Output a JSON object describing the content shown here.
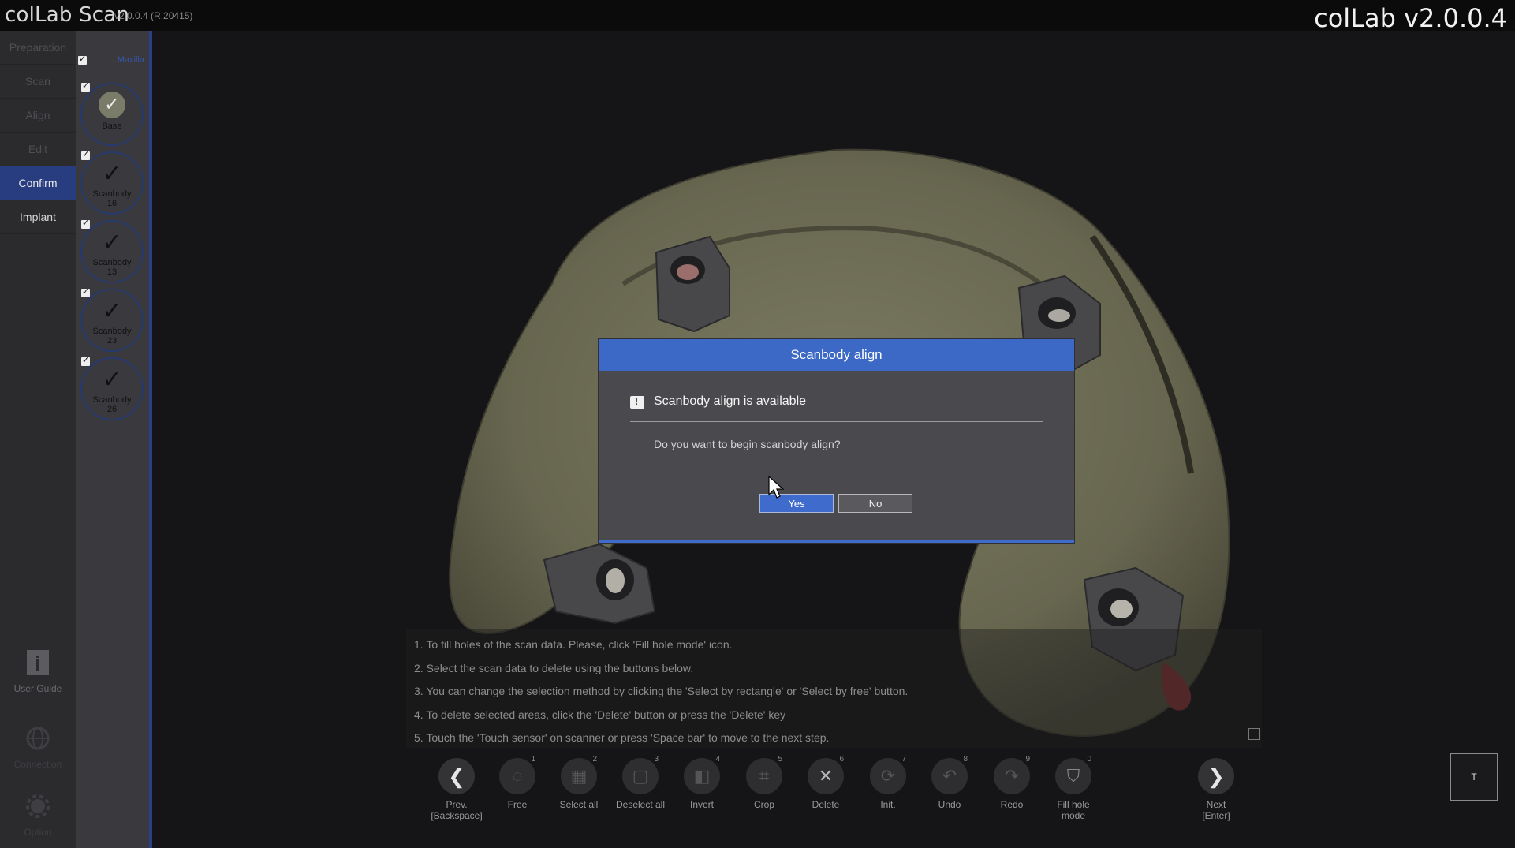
{
  "titlebar": {
    "app_name": "colLab Scan",
    "version": "v2.0.0.4",
    "build": "(R.20415)",
    "brand": "colLab v2.0.0.4"
  },
  "steps": [
    "Preparation",
    "Scan",
    "Align",
    "Edit",
    "Confirm",
    "Implant"
  ],
  "active_step": "Confirm",
  "bottom_tools": {
    "user_guide": "User Guide",
    "connection": "Connection",
    "option": "Option"
  },
  "scanbody_panel": {
    "maxilla": "Maxilla",
    "items": [
      {
        "label": "Base",
        "sub": ""
      },
      {
        "label": "Scanbody",
        "sub": "16"
      },
      {
        "label": "Scanbody",
        "sub": "13"
      },
      {
        "label": "Scanbody",
        "sub": "23"
      },
      {
        "label": "Scanbody",
        "sub": "26"
      }
    ]
  },
  "instructions": [
    "1. To fill holes of the scan data. Please, click 'Fill hole mode' icon.",
    "2. Select the scan data to delete using the buttons below.",
    "3. You can change the selection method by clicking the 'Select by rectangle' or 'Select by free' button.",
    "4. To delete selected areas, click the 'Delete' button or press the 'Delete' key",
    "5. Touch the 'Touch sensor' on scanner or press 'Space bar' to move to the next step."
  ],
  "toolbar": {
    "prev": {
      "label": "Prev.",
      "key": "[Backspace]"
    },
    "next": {
      "label": "Next",
      "key": "[Enter]"
    },
    "tools": [
      {
        "label": "Free",
        "num": "1",
        "icon": "lasso-icon"
      },
      {
        "label": "Select all",
        "num": "2",
        "icon": "select-all-icon"
      },
      {
        "label": "Deselect all",
        "num": "3",
        "icon": "deselect-all-icon"
      },
      {
        "label": "Invert",
        "num": "4",
        "icon": "invert-icon"
      },
      {
        "label": "Crop",
        "num": "5",
        "icon": "crop-icon"
      },
      {
        "label": "Delete",
        "num": "6",
        "icon": "delete-icon"
      },
      {
        "label": "Init.",
        "num": "7",
        "icon": "init-icon"
      },
      {
        "label": "Undo",
        "num": "8",
        "icon": "undo-icon"
      },
      {
        "label": "Redo",
        "num": "9",
        "icon": "redo-icon"
      },
      {
        "label": "Fill hole mode",
        "num": "0",
        "icon": "fill-hole-icon"
      }
    ],
    "t_button": "T"
  },
  "dialog": {
    "header": "Scanbody align",
    "title": "Scanbody align is available",
    "message": "Do you want to begin scanbody align?",
    "yes": "Yes",
    "no": "No"
  },
  "colors": {
    "accent": "#3c69c6",
    "nav_active": "#283d80",
    "model": "#6f6d55"
  }
}
